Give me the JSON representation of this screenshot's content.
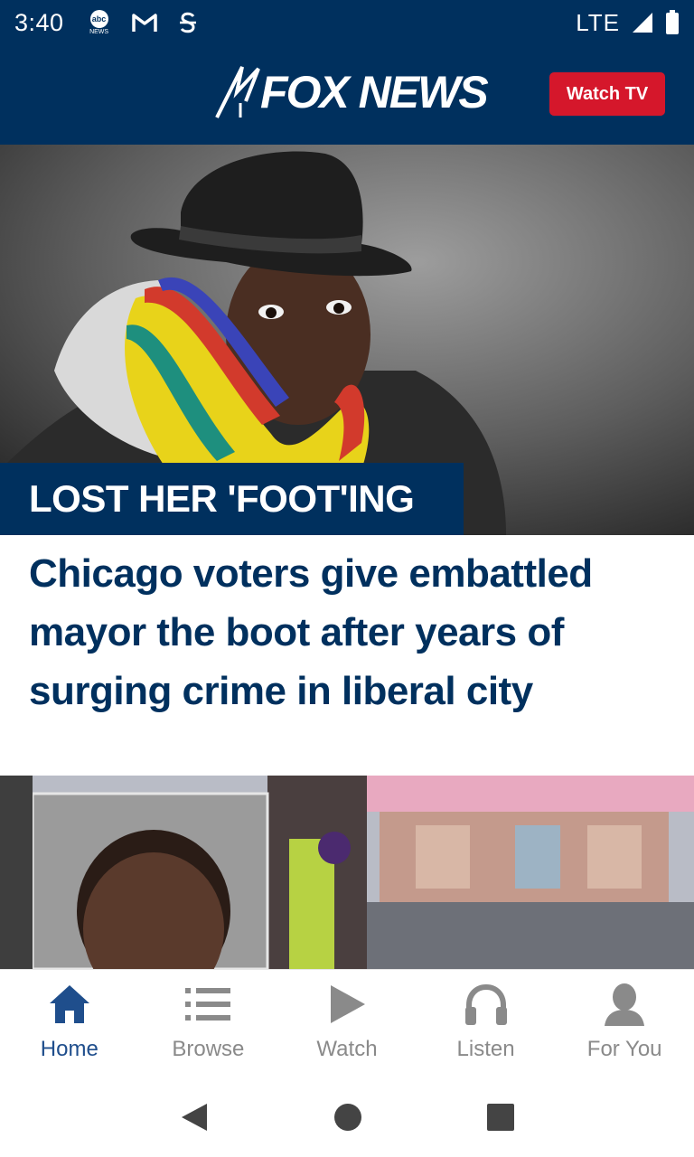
{
  "status_bar": {
    "time": "3:40",
    "network": "LTE",
    "abc_icon_text": "abc",
    "abc_icon_sub": "NEWS",
    "left_icons": [
      "abc-news-icon",
      "gmail-icon",
      "app-icon"
    ],
    "right_icons": [
      "signal-icon",
      "battery-icon"
    ]
  },
  "header": {
    "logo_text": "FOX NEWS",
    "watch_tv_label": "Watch TV",
    "brand_color": "#00305e",
    "accent_color": "#d5172b"
  },
  "hero_story": {
    "kicker": "LOST HER 'FOOT'ING",
    "headline": "Chicago voters give embattled mayor the boot after years of surging crime in liberal city"
  },
  "bottom_nav": {
    "items": [
      {
        "label": "Home",
        "icon": "home-icon",
        "active": true
      },
      {
        "label": "Browse",
        "icon": "list-icon",
        "active": false
      },
      {
        "label": "Watch",
        "icon": "play-icon",
        "active": false
      },
      {
        "label": "Listen",
        "icon": "headphones-icon",
        "active": false
      },
      {
        "label": "For You",
        "icon": "person-icon",
        "active": false
      }
    ],
    "active_color": "#1f4e8c",
    "inactive_color": "#8a8a8a"
  },
  "system_nav": {
    "icons": [
      "back-icon",
      "home-circle-icon",
      "recents-icon"
    ]
  }
}
